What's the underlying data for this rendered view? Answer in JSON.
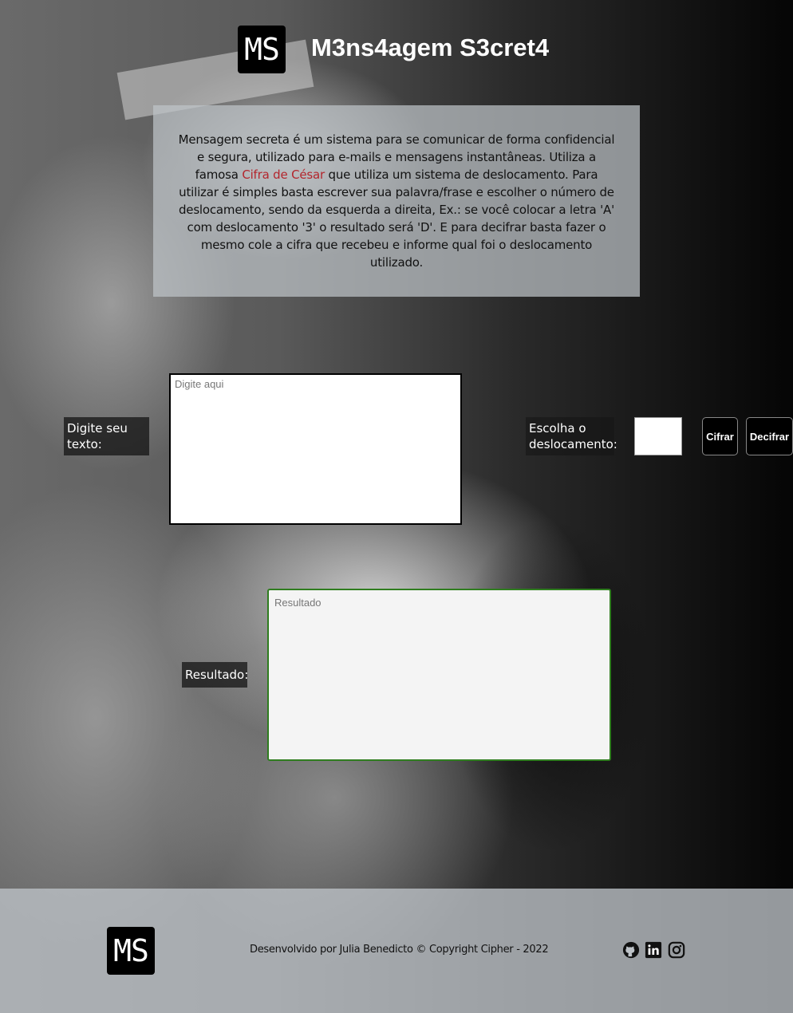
{
  "header": {
    "logo_text": "MS",
    "title": "M3ns4agem S3cret4"
  },
  "description": {
    "before_link": "Mensagem secreta é um sistema para se comunicar de forma confidencial e segura, utilizado para e-mails e mensagens instantâneas. Utiliza a famosa ",
    "link_text": "Cifra de César",
    "after_link": " que utiliza um sistema de deslocamento. Para utilizar é simples basta escrever sua palavra/frase e escolher o número de deslocamento, sendo da esquerda a direita, Ex.: se você colocar a letra 'A' com deslocamento '3' o resultado será 'D'. E para decifrar basta fazer o mesmo cole a cifra que recebeu e informe qual foi o deslocamento utilizado."
  },
  "form": {
    "text_label": "Digite seu texto:",
    "text_placeholder": "Digite aqui",
    "text_value": "",
    "shift_label": "Escolha o deslocamento:",
    "shift_value": "",
    "cifrar_label": "Cifrar",
    "decifrar_label": "Decifrar",
    "result_label": "Resultado:",
    "result_placeholder": "Resultado",
    "result_value": ""
  },
  "footer": {
    "logo_text": "MS",
    "credits": "Desenvolvido por Julia Benedicto © Copyright Cipher - 2022",
    "social": [
      "github-icon",
      "linkedin-icon",
      "instagram-icon"
    ]
  },
  "colors": {
    "link": "#b3262d",
    "result_border": "#2f7d1f",
    "card_bg": "#bec3c8"
  }
}
